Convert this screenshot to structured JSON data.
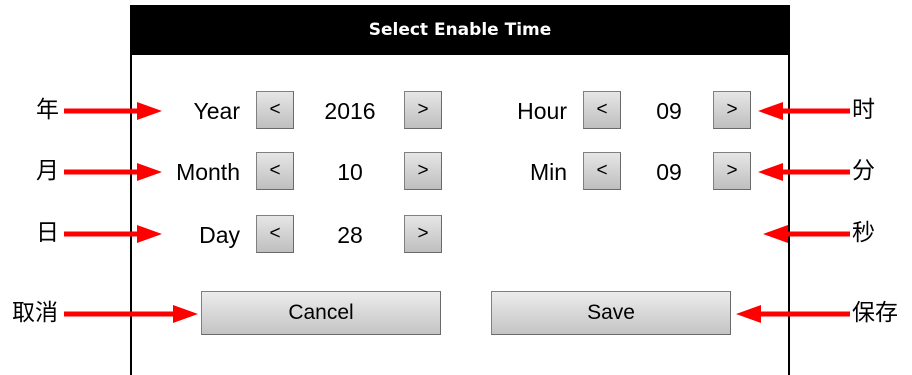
{
  "dialog": {
    "title": "Select Enable Time",
    "fields": {
      "year": {
        "label": "Year",
        "value": "2016",
        "dec": "<",
        "inc": ">"
      },
      "month": {
        "label": "Month",
        "value": "10",
        "dec": "<",
        "inc": ">"
      },
      "day": {
        "label": "Day",
        "value": "28",
        "dec": "<",
        "inc": ">"
      },
      "hour": {
        "label": "Hour",
        "value": "09",
        "dec": "<",
        "inc": ">"
      },
      "min": {
        "label": "Min",
        "value": "09",
        "dec": "<",
        "inc": ">"
      }
    },
    "buttons": {
      "cancel": "Cancel",
      "save": "Save"
    }
  },
  "annotations": {
    "year": "年",
    "month": "月",
    "day": "日",
    "hour": "时",
    "minute": "分",
    "second": "秒",
    "cancel": "取消",
    "save": "保存"
  },
  "colors": {
    "title_bar": "#000000",
    "arrow": "#ff0000",
    "button_top": "#ececec",
    "button_bottom": "#c4c4c4"
  }
}
